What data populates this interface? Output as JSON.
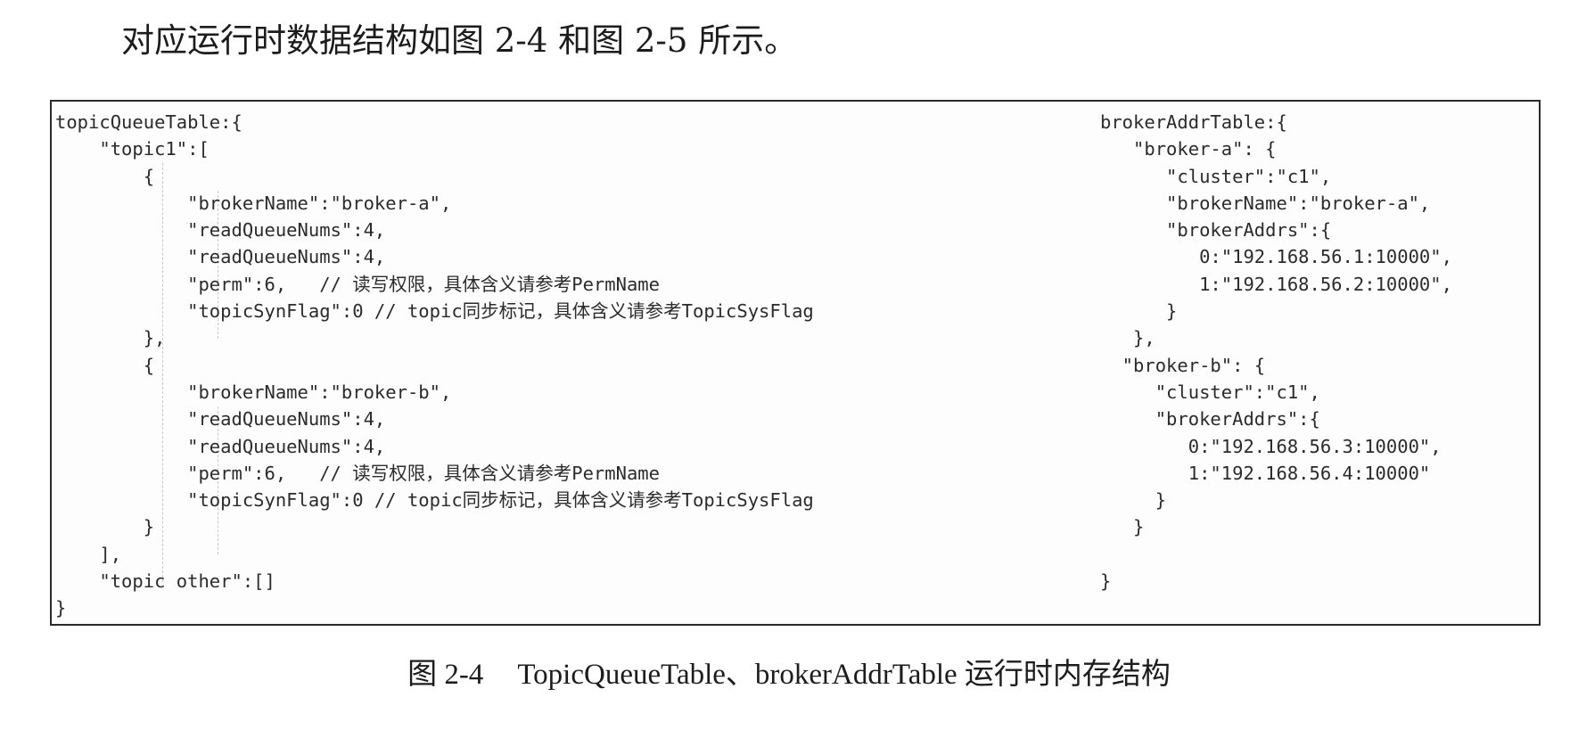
{
  "intro_text": "对应运行时数据结构如图 2-4 和图 2-5 所示。",
  "code_left": [
    "topicQueueTable:{",
    "    \"topic1\":[",
    "        {",
    "            \"brokerName\":\"broker-a\",",
    "            \"readQueueNums\":4,",
    "            \"readQueueNums\":4,",
    "            \"perm\":6,   // 读写权限，具体含义请参考PermName",
    "            \"topicSynFlag\":0 // topic同步标记，具体含义请参考TopicSysFlag",
    "        },",
    "        {",
    "            \"brokerName\":\"broker-b\",",
    "            \"readQueueNums\":4,",
    "            \"readQueueNums\":4,",
    "            \"perm\":6,   // 读写权限，具体含义请参考PermName",
    "            \"topicSynFlag\":0 // topic同步标记，具体含义请参考TopicSysFlag",
    "        }",
    "    ],",
    "    \"topic other\":[]",
    "}"
  ],
  "code_right": [
    "brokerAddrTable:{",
    "   \"broker-a\": {",
    "      \"cluster\":\"c1\",",
    "      \"brokerName\":\"broker-a\",",
    "      \"brokerAddrs\":{",
    "         0:\"192.168.56.1:10000\",",
    "         1:\"192.168.56.2:10000\",",
    "      }",
    "   },",
    "  \"broker-b\": {",
    "     \"cluster\":\"c1\",",
    "     \"brokerAddrs\":{",
    "        0:\"192.168.56.3:10000\",",
    "        1:\"192.168.56.4:10000\"",
    "     }",
    "   }",
    "",
    "}"
  ],
  "caption": {
    "figure_number": "图 2-4",
    "text": "TopicQueueTable、brokerAddrTable 运行时内存结构"
  }
}
